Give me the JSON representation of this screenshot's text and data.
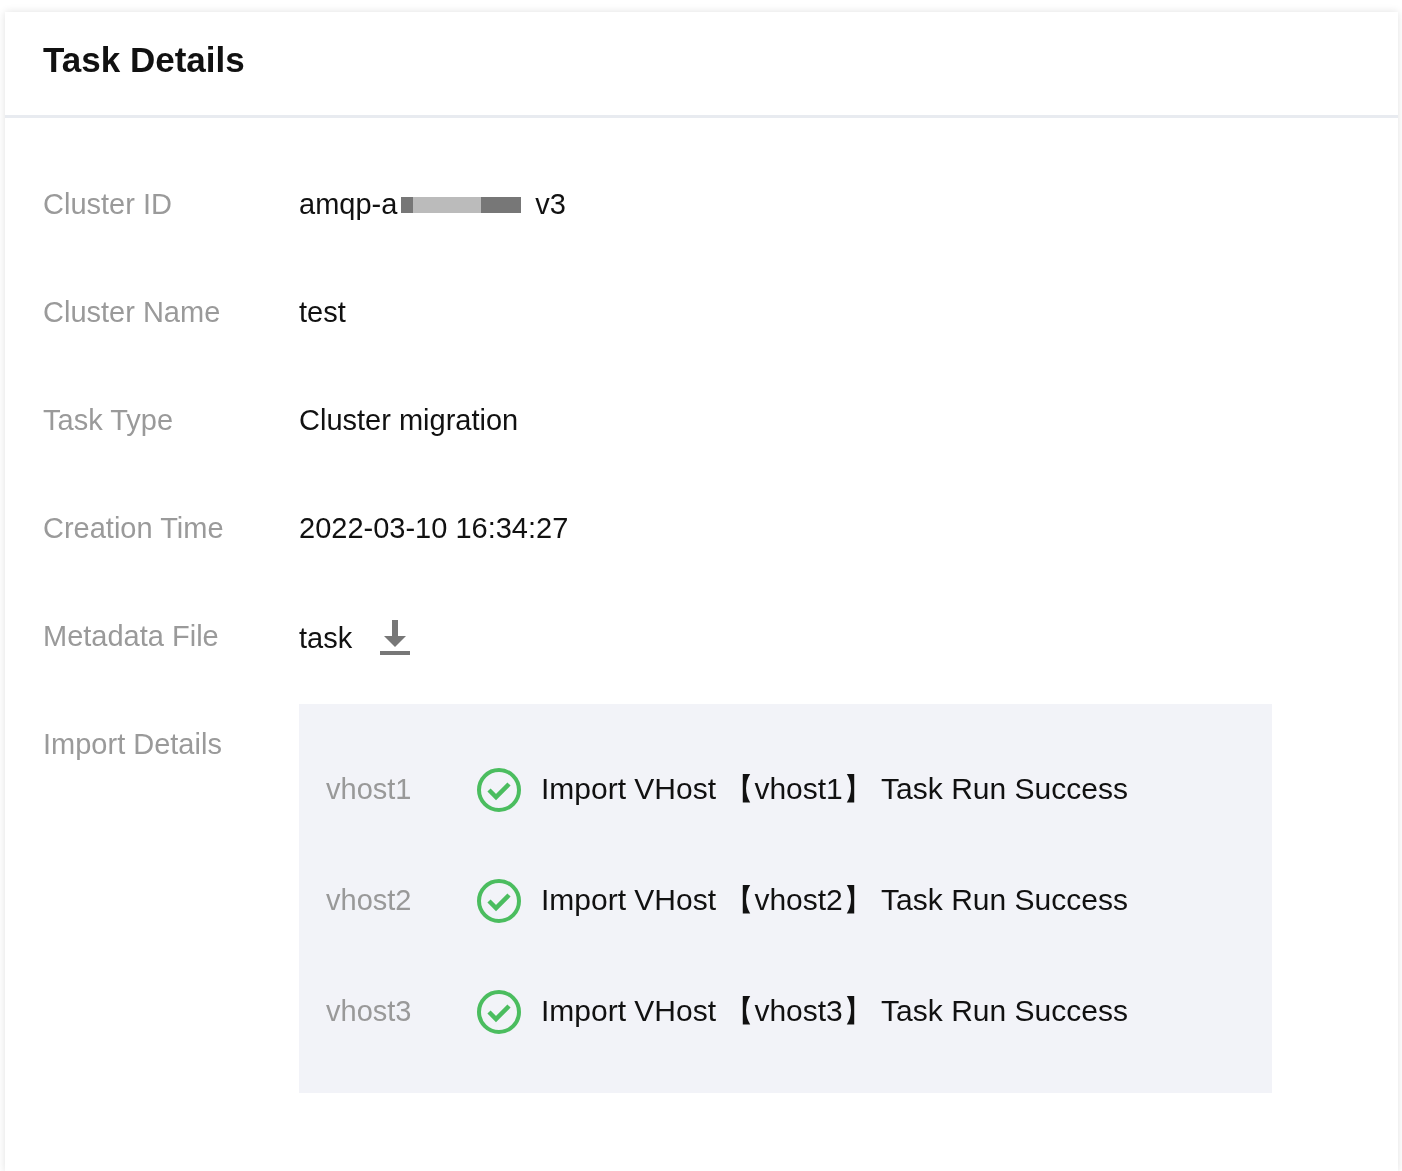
{
  "title": "Task Details",
  "fields": [
    {
      "kind": "redacted",
      "label": "Cluster ID",
      "value": "amqp-a",
      "value_tail": "v3"
    },
    {
      "kind": "text",
      "label": "Cluster Name",
      "value": "test"
    },
    {
      "kind": "text",
      "label": "Task Type",
      "value": "Cluster migration"
    },
    {
      "kind": "text",
      "label": "Creation Time",
      "value": "2022-03-10 16:34:27"
    },
    {
      "kind": "download",
      "label": "Metadata File",
      "value": "task"
    }
  ],
  "import_details": {
    "label": "Import Details",
    "rows": [
      {
        "vhost": "vhost1",
        "success": true,
        "message": "Import VHost 【vhost1】 Task Run Success"
      },
      {
        "vhost": "vhost2",
        "success": true,
        "message": "Import VHost 【vhost2】 Task Run Success"
      },
      {
        "vhost": "vhost3",
        "success": true,
        "message": "Import VHost 【vhost3】 Task Run Success"
      }
    ]
  }
}
